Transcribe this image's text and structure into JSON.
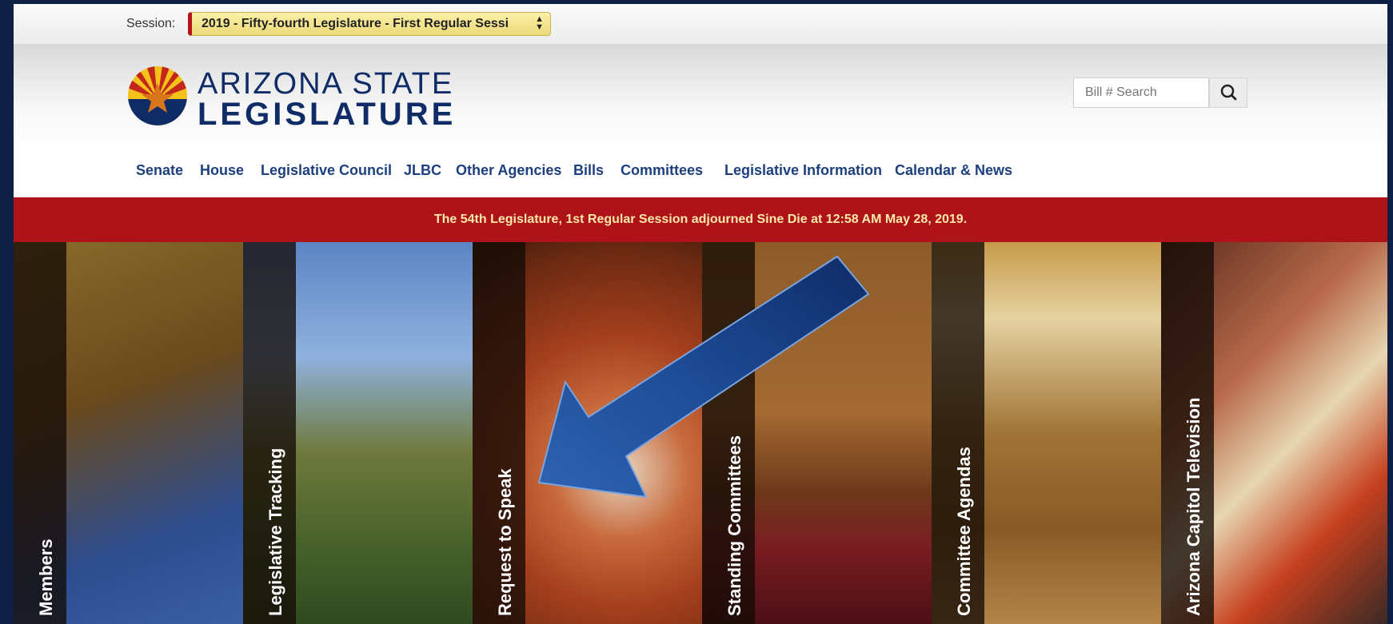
{
  "session": {
    "label": "Session:",
    "selected": "2019 - Fifty-fourth Legislature - First Regular Sessi"
  },
  "logo": {
    "line1": "ARIZONA STATE",
    "line2": "LEGISLATURE"
  },
  "search": {
    "placeholder": "Bill # Search"
  },
  "nav": {
    "items": [
      "Senate",
      "House",
      "Legislative Council",
      "JLBC",
      "Other Agencies",
      "Bills",
      "Committees",
      "Legislative Information",
      "Calendar & News"
    ]
  },
  "alert": {
    "text": "The 54th Legislature, 1st Regular Session adjourned Sine Die at 12:58 AM May 28, 2019."
  },
  "tiles": [
    {
      "label": "Members"
    },
    {
      "label": "Legislative Tracking"
    },
    {
      "label": "Request to Speak"
    },
    {
      "label": "Standing Committees"
    },
    {
      "label": "Committee Agendas"
    },
    {
      "label": "Arizona Capitol Television"
    }
  ],
  "colors": {
    "brand_navy": "#0f2c67",
    "alert_red": "#ad1319",
    "alert_text": "#fce8a8",
    "nav_link": "#1c3f7e",
    "session_highlight": "#ecd979",
    "arrow_blue": "#1f4f9a"
  },
  "icons": [
    "arizona-flag-emblem-icon",
    "search-icon",
    "select-arrows-icon",
    "arrow-pointer-icon"
  ]
}
